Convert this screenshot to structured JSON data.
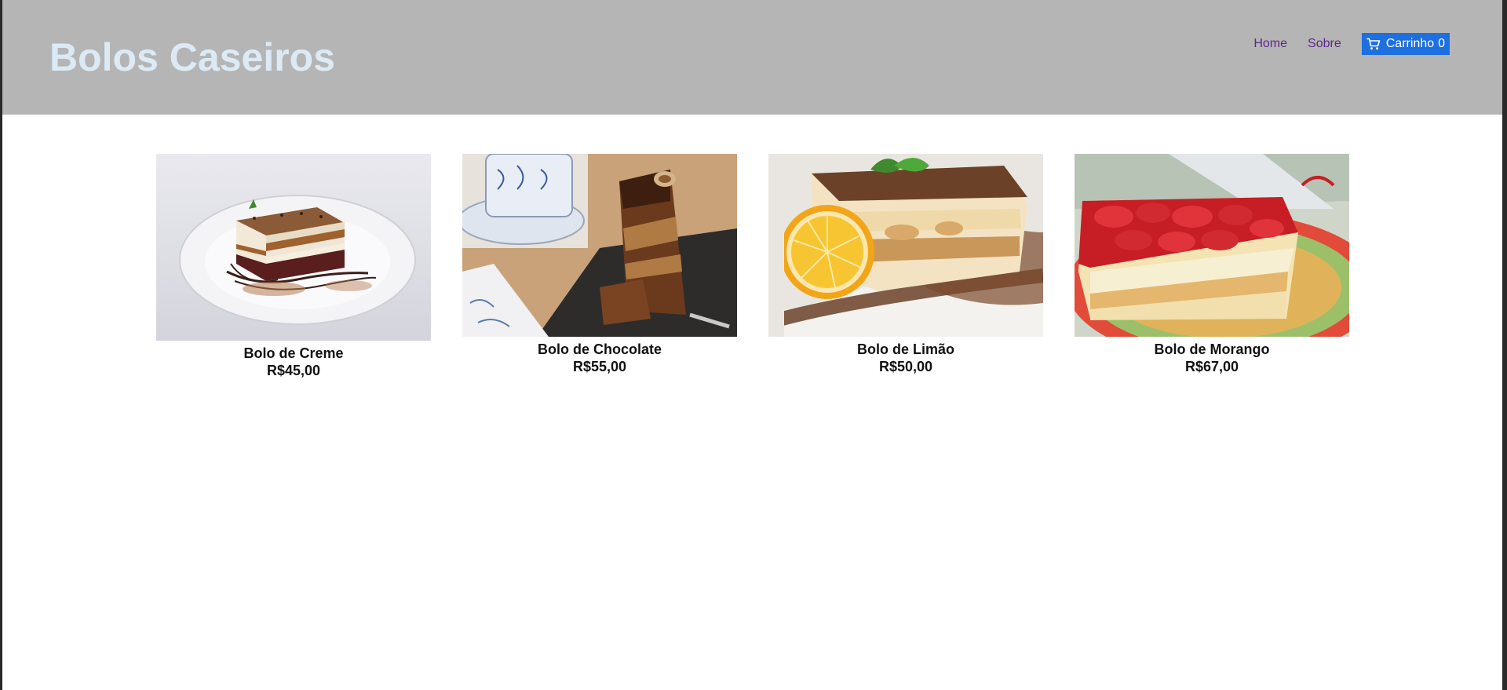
{
  "header": {
    "title": "Bolos Caseiros",
    "nav": {
      "home": "Home",
      "about": "Sobre"
    },
    "cart": {
      "label": "Carrinho",
      "count": "0",
      "icon": "cart-icon"
    }
  },
  "products": [
    {
      "name": "Bolo de Creme",
      "price": "R$45,00"
    },
    {
      "name": "Bolo de Chocolate",
      "price": "R$55,00"
    },
    {
      "name": "Bolo de Limão",
      "price": "R$50,00"
    },
    {
      "name": "Bolo de Morango",
      "price": "R$67,00"
    }
  ]
}
